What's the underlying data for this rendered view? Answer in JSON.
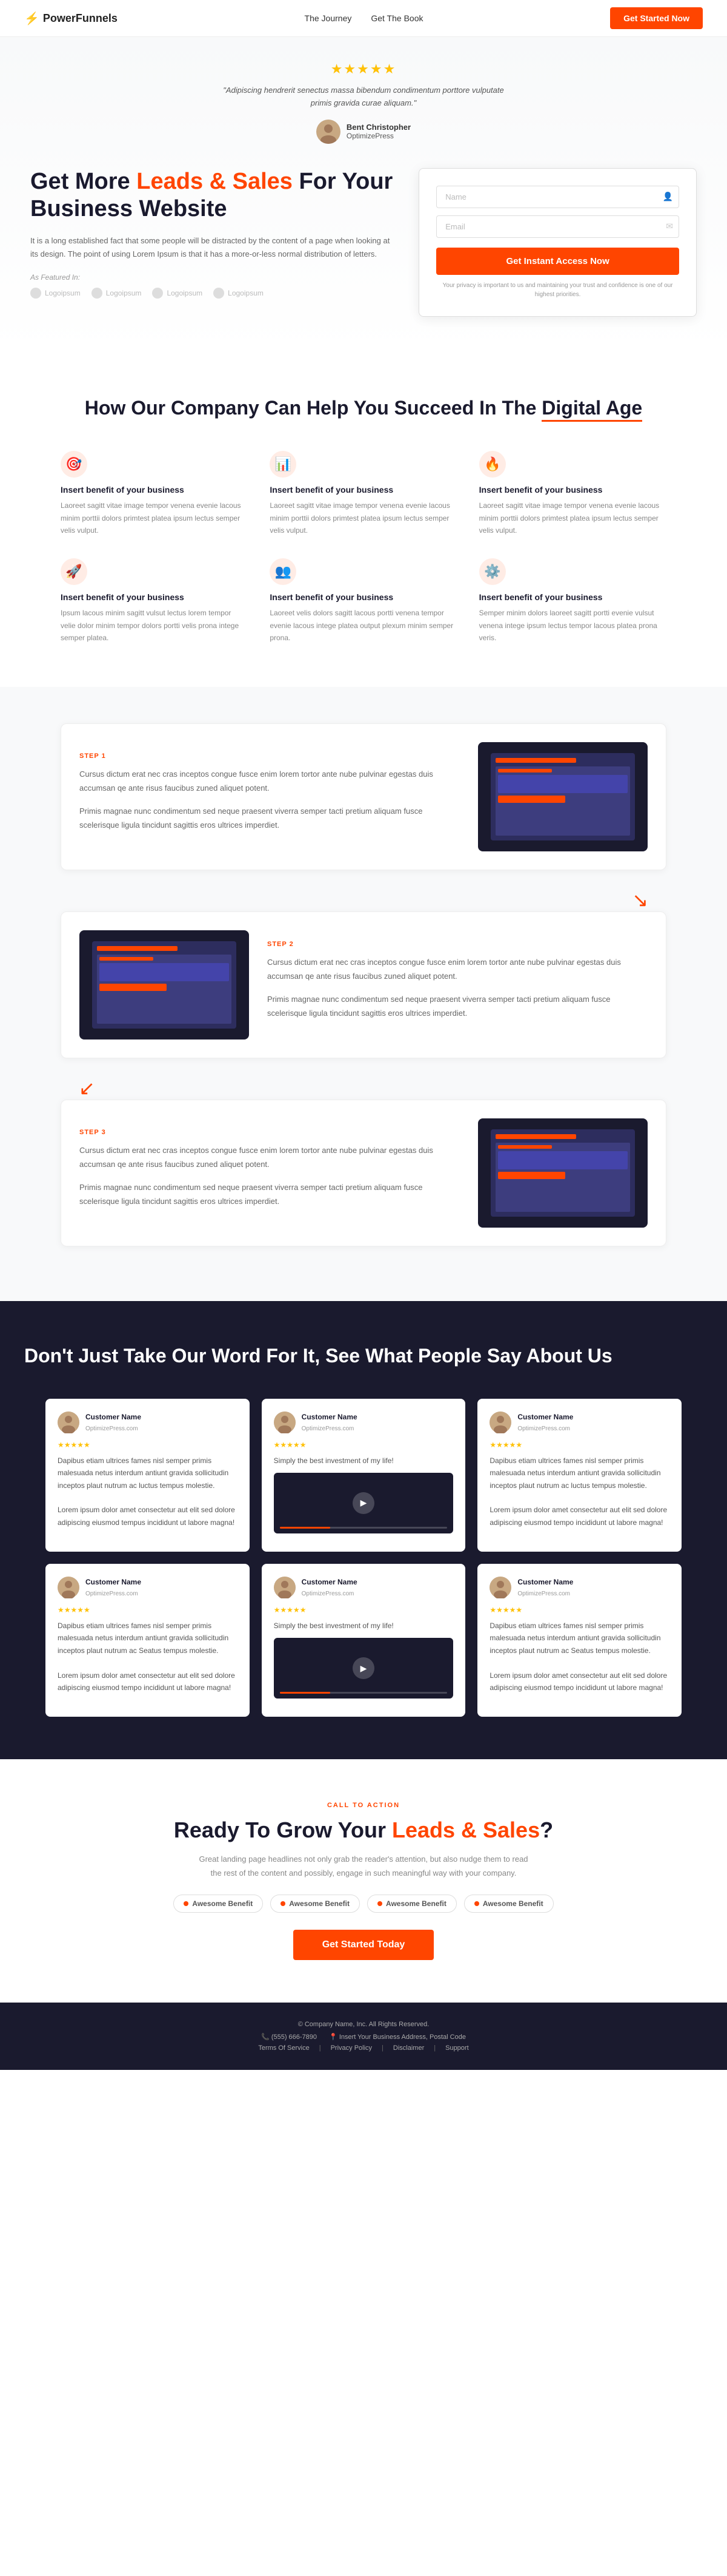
{
  "navbar": {
    "logo": "PowerFunnels",
    "bolt_icon": "⚡",
    "links": [
      {
        "label": "The Journey",
        "href": "#"
      },
      {
        "label": "Get The Book",
        "href": "#"
      }
    ],
    "cta_label": "Get Started Now"
  },
  "hero": {
    "stars": "★★★★★",
    "quote": "\"Adipiscing hendrerit senectus massa bibendum condimentum porttore vulputate primis gravida curae aliquam.\"",
    "author_name": "Bent Christopher",
    "author_sub": "OptimizePress",
    "title_part1": "Get More ",
    "title_highlight": "Leads & Sales",
    "title_part2": " For Your Business Website",
    "desc": "It is a long established fact that some people will be distracted by the content of a page when looking at its design. The point of using Lorem Ipsum is that it has a more-or-less normal distribution of letters.",
    "featured_label": "As Featured In:",
    "logos": [
      "Logoipsum",
      "Logoipsum",
      "Logoipsum",
      "Logoipsum"
    ],
    "form": {
      "name_placeholder": "Name",
      "email_placeholder": "Email",
      "cta_label": "Get Instant Access Now",
      "privacy_text": "Your privacy is important to us and maintaining your trust and confidence is one of our highest priorities."
    }
  },
  "section_how": {
    "title_part1": "How Our Company Can Help You Succeed In The ",
    "title_highlight": "Digital Age",
    "benefits": [
      {
        "icon": "🎯",
        "title": "Insert benefit of your business",
        "desc": "Laoreet sagitt vitae image tempor venena evenie lacous minim porttii dolors primtest platea ipsum lectus semper velis vulput."
      },
      {
        "icon": "📊",
        "title": "Insert benefit of your business",
        "desc": "Laoreet sagitt vitae image tempor venena evenie lacous minim porttii dolors primtest platea ipsum lectus semper velis vulput."
      },
      {
        "icon": "🔥",
        "title": "Insert benefit of your business",
        "desc": "Laoreet sagitt vitae image tempor venena evenie lacous minim porttii dolors primtest platea ipsum lectus semper velis vulput."
      },
      {
        "icon": "🚀",
        "title": "Insert benefit of your business",
        "desc": "Ipsum lacous minim sagitt vulsut lectus lorem tempor velie dolor minim tempor dolors portti velis prona intege semper platea."
      },
      {
        "icon": "👥",
        "title": "Insert benefit of your business",
        "desc": "Laoreet velis dolors sagitt lacous portti venena tempor evenie lacous intege platea output plexum minim semper prona."
      },
      {
        "icon": "⚙️",
        "title": "Insert benefit of your business",
        "desc": "Semper minim dolors laoreet sagitt portti evenie vulsut venena intege ipsum lectus tempor lacous platea prona veris."
      }
    ]
  },
  "steps": [
    {
      "label": "STEP 1",
      "desc1": "Cursus dictum erat nec cras inceptos congue fusce enim lorem tortor ante nube pulvinar egestas duis accumsan qe ante risus faucibus zuned aliquet potent.",
      "desc2": "Primis magnae nunc condimentum sed neque praesent viverra semper tacti pretium aliquam fusce scelerisque ligula tincidunt sagittis eros ultrices imperdiet.",
      "reverse": false
    },
    {
      "label": "STEP 2",
      "desc1": "Cursus dictum erat nec cras inceptos congue fusce enim lorem tortor ante nube pulvinar egestas duis accumsan qe ante risus faucibus zuned aliquet potent.",
      "desc2": "Primis magnae nunc condimentum sed neque praesent viverra semper tacti pretium aliquam fusce scelerisque ligula tincidunt sagittis eros ultrices imperdiet.",
      "reverse": true
    },
    {
      "label": "STEP 3",
      "desc1": "Cursus dictum erat nec cras inceptos congue fusce enim lorem tortor ante nube pulvinar egestas duis accumsan qe ante risus faucibus zuned aliquet potent.",
      "desc2": "Primis magnae nunc condimentum sed neque praesent viverra semper tacti pretium aliquam fusce scelerisque ligula tincidunt sagittis eros ultrices imperdiet.",
      "reverse": false
    }
  ],
  "testimonials_section": {
    "title": "Don't Just Take Our Word For It, See What People Say About Us",
    "items": [
      {
        "name": "Customer Name",
        "sub": "OptimizePress.com",
        "stars": "★★★★★",
        "type": "text",
        "text": "Dapibus etiam ultrices fames nisl semper primis malesuada netus interdum antiunt gravida sollicitudin inceptos plaut nutrum ac luctus tempus molestie.\n\nLorem ipsum dolor amet consectetur aut elit sed dolore adipiscing eiusmod tempus incididunt ut labore magna!"
      },
      {
        "name": "Customer Name",
        "sub": "OptimizePress.com",
        "stars": "★★★★★",
        "type": "video",
        "text": "Simply the best investment of my life!"
      },
      {
        "name": "Customer Name",
        "sub": "OptimizePress.com",
        "stars": "★★★★★",
        "type": "text",
        "text": "Dapibus etiam ultrices fames nisl semper primis malesuada netus interdum antiunt gravida sollicitudin inceptos plaut nutrum ac luctus tempus molestie.\n\nLorem ipsum dolor amet consectetur aut elit sed dolore adipiscing eiusmod tempo incididunt ut labore magna!"
      },
      {
        "name": "Customer Name",
        "sub": "OptimizePress.com",
        "stars": "★★★★★",
        "type": "text",
        "text": "Dapibus etiam ultrices fames nisl semper primis malesuada netus interdum antiunt gravida sollicitudin inceptos plaut nutrum ac Seatus tempus molestie.\n\nLorem ipsum dolor amet consectetur aut elit sed dolore adipiscing eiusmod tempo incididunt ut labore magna!"
      },
      {
        "name": "Customer Name",
        "sub": "OptimizePress.com",
        "stars": "★★★★★",
        "type": "video",
        "text": "Simply the best investment of my life!"
      },
      {
        "name": "Customer Name",
        "sub": "OptimizePress.com",
        "stars": "★★★★★",
        "type": "text",
        "text": "Dapibus etiam ultrices fames nisl semper primis malesuada netus interdum antiunt gravida sollicitudin inceptos plaut nutrum ac Seatus tempus molestie.\n\nLorem ipsum dolor amet consectetur aut elit sed dolore adipiscing eiusmod tempo incididunt ut labore magna!"
      }
    ]
  },
  "cta_section": {
    "label": "CALL TO ACTION",
    "title_part1": "Ready To Grow Your ",
    "title_highlight": "Leads & Sales",
    "title_part2": "?",
    "desc": "Great landing page headlines not only grab the reader's attention, but also nudge them to read the rest of the content and possibly, engage in such meaningful way with your company.",
    "badges": [
      "Awesome Benefit",
      "Awesome Benefit",
      "Awesome Benefit",
      "Awesome Benefit"
    ],
    "cta_label": "Get Started Today"
  },
  "footer": {
    "copy": "© Company Name, Inc. All Rights Reserved.",
    "phone": "(555) 666-7890",
    "address": "Insert Your Business Address, Postal Code",
    "links": [
      "Terms Of Service",
      "Privacy Policy",
      "Disclaimer",
      "Support"
    ]
  }
}
